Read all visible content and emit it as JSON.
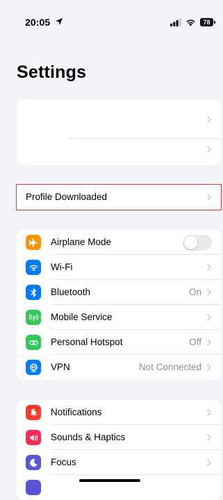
{
  "status_bar": {
    "time": "20:05",
    "battery": "78"
  },
  "page": {
    "title": "Settings"
  },
  "profile": {
    "label": "Profile Downloaded"
  },
  "connectivity": {
    "items": [
      {
        "label": "Airplane Mode",
        "value": "",
        "icon": "airplane-icon",
        "color": "#ff9500"
      },
      {
        "label": "Wi-Fi",
        "value": "",
        "icon": "wifi-icon",
        "color": "#007aff"
      },
      {
        "label": "Bluetooth",
        "value": "On",
        "icon": "bluetooth-icon",
        "color": "#007aff"
      },
      {
        "label": "Mobile Service",
        "value": "",
        "icon": "antenna-icon",
        "color": "#34c759"
      },
      {
        "label": "Personal Hotspot",
        "value": "Off",
        "icon": "hotspot-icon",
        "color": "#34c759"
      },
      {
        "label": "VPN",
        "value": "Not Connected",
        "icon": "globe-icon",
        "color": "#007aff"
      }
    ],
    "airplane_mode_on": false
  },
  "notifications": {
    "items": [
      {
        "label": "Notifications",
        "icon": "bell-icon",
        "color": "#ff3b30"
      },
      {
        "label": "Sounds & Haptics",
        "icon": "speaker-icon",
        "color": "#ff2d55"
      },
      {
        "label": "Focus",
        "icon": "moon-icon",
        "color": "#5856d6"
      }
    ]
  }
}
